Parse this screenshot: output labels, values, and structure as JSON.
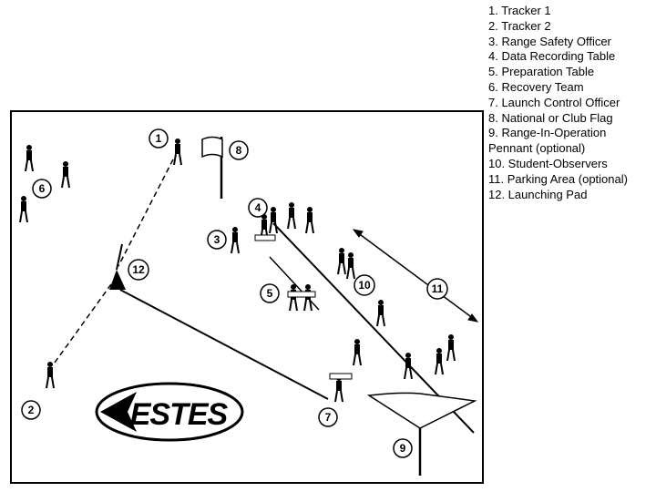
{
  "legend": {
    "items": [
      "1. Tracker 1",
      "2. Tracker 2",
      "3. Range Safety Officer",
      "4. Data Recording Table",
      "5. Preparation Table",
      "6. Recovery Team",
      "7. Launch Control Officer",
      "8. National or Club Flag",
      "9. Range-In-Operation",
      "Pennant (optional)",
      "10. Student-Observers",
      "11. Parking Area (optional)",
      "12. Launching Pad"
    ]
  },
  "diagram": {
    "markers": [
      "1",
      "2",
      "3",
      "4",
      "5",
      "6",
      "7",
      "8",
      "9",
      "10",
      "11",
      "12"
    ],
    "logo": "ESTES"
  },
  "colors": {
    "line": "#000000",
    "background": "#ffffff"
  }
}
